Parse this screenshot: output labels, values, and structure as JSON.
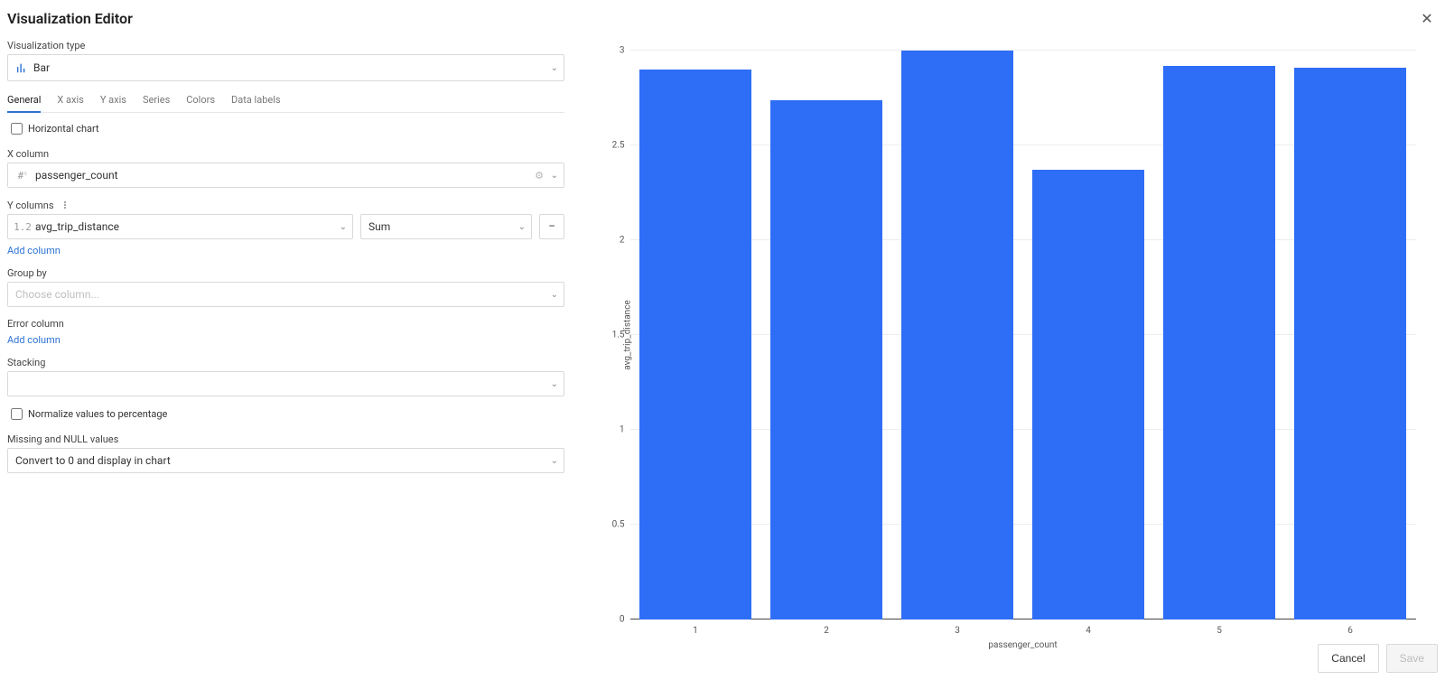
{
  "header": {
    "title": "Visualization Editor"
  },
  "panel": {
    "viz_type_label": "Visualization type",
    "viz_type_value": "Bar",
    "tabs": [
      "General",
      "X axis",
      "Y axis",
      "Series",
      "Colors",
      "Data labels"
    ],
    "active_tab": 0,
    "horizontal_chart_label": "Horizontal chart",
    "xcol_label": "X column",
    "xcol_value": "passenger_count",
    "ycols_label": "Y columns",
    "ycol0_value": "avg_trip_distance",
    "ycol0_agg": "Sum",
    "add_column_link": "Add column",
    "groupby_label": "Group by",
    "groupby_placeholder": "Choose column...",
    "errcol_label": "Error column",
    "stacking_label": "Stacking",
    "stacking_value": "",
    "normalize_label": "Normalize values to percentage",
    "missing_label": "Missing and NULL values",
    "missing_value": "Convert to 0 and display in chart"
  },
  "footer": {
    "cancel": "Cancel",
    "save": "Save"
  },
  "chart_data": {
    "type": "bar",
    "categories": [
      "1",
      "2",
      "3",
      "4",
      "5",
      "6"
    ],
    "values": [
      2.9,
      2.74,
      3.0,
      2.37,
      2.92,
      2.91
    ],
    "xlabel": "passenger_count",
    "ylabel": "avg_trip_distance",
    "ylim": [
      0,
      3
    ],
    "yticks": [
      0,
      0.5,
      1,
      1.5,
      2,
      2.5,
      3
    ]
  }
}
